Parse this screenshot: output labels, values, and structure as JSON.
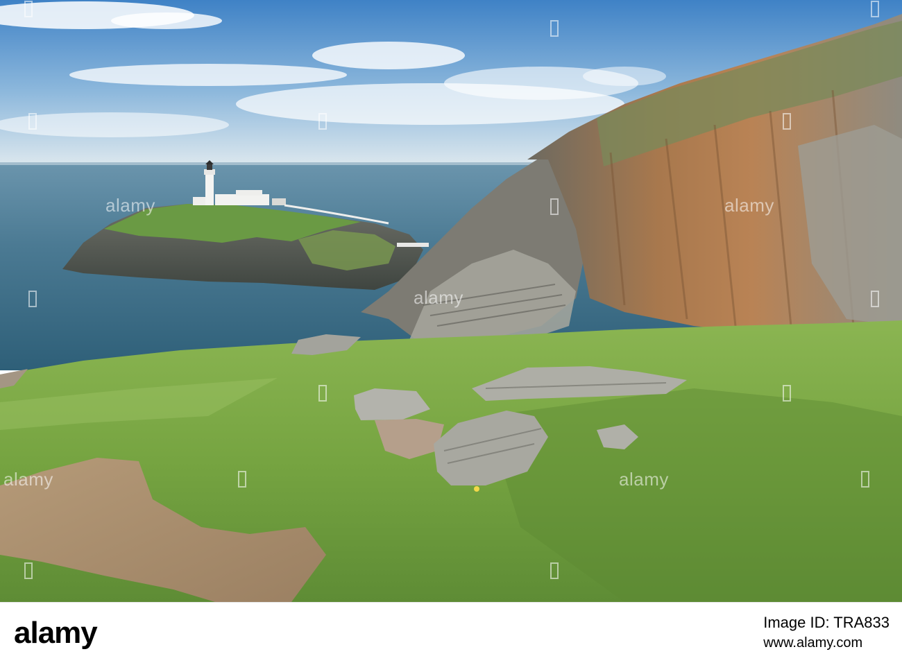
{
  "watermark": {
    "text": "alamy",
    "color": "#ffffff"
  },
  "footer": {
    "logo_text": "alamy",
    "image_id": "Image ID: TRA833",
    "site_url": "www.alamy.com"
  },
  "scene": {
    "description_colors": {
      "sky_top": "#4a8ccc",
      "sky_horizon": "#d8e6ee",
      "sea": "#3f6f8a",
      "grass": "#7aa84a",
      "cliff_orange": "#b07a4a",
      "rock_grey": "#8a8a82",
      "lighthouse": "#f4f4f2"
    }
  }
}
